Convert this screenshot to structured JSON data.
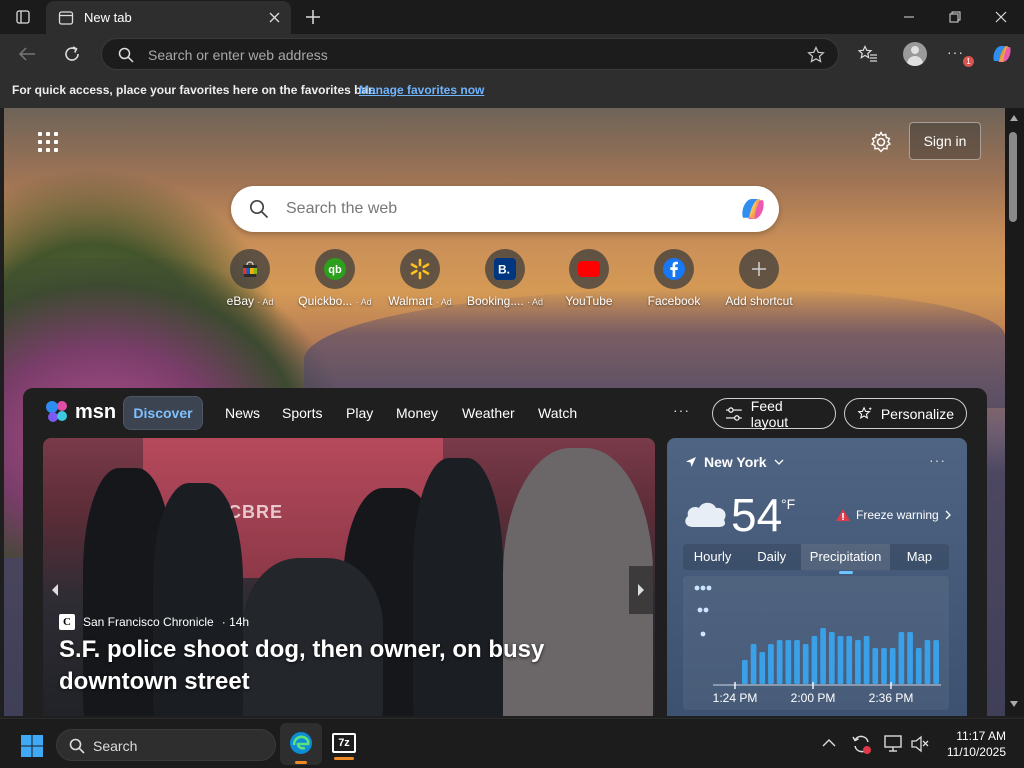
{
  "browser": {
    "tab_title": "New tab",
    "address_placeholder": "Search or enter web address",
    "favorites_message": "For quick access, place your favorites here on the favorites bar.",
    "favorites_link": "Manage favorites now",
    "profile_badge": "1"
  },
  "newtab": {
    "signin_label": "Sign in",
    "search_placeholder": "Search the web",
    "shortcuts": [
      {
        "label": "eBay",
        "ad": "· Ad",
        "icon": "ebay-icon",
        "color": "#4a4a4a"
      },
      {
        "label": "Quickbo...",
        "ad": "· Ad",
        "icon": "quickbooks-icon",
        "color": "#2ca01c"
      },
      {
        "label": "Walmart",
        "ad": "· Ad",
        "icon": "walmart-icon",
        "color": "#1a5ea8"
      },
      {
        "label": "Booking....",
        "ad": "· Ad",
        "icon": "booking-icon",
        "color": "#003580"
      },
      {
        "label": "YouTube",
        "ad": "",
        "icon": "youtube-icon",
        "color": "#ff0000"
      },
      {
        "label": "Facebook",
        "ad": "",
        "icon": "facebook-icon",
        "color": "#1877f2"
      },
      {
        "label": "Add shortcut",
        "ad": "",
        "icon": "plus-icon",
        "color": "#666666"
      }
    ]
  },
  "feed": {
    "brand": "msn",
    "nav": [
      "Discover",
      "News",
      "Sports",
      "Play",
      "Money",
      "Weather",
      "Watch"
    ],
    "more": "···",
    "feed_layout_label": "Feed layout",
    "personalize_label": "Personalize",
    "hero": {
      "source": "San Francisco Chronicle",
      "time": "· 14h",
      "sign_text": "CBRE",
      "headline": "S.F. police shoot dog, then owner, on busy downtown street"
    },
    "weather": {
      "location": "New York",
      "temperature": "54",
      "unit": "°F",
      "warning": "Freeze warning",
      "tabs": [
        "Hourly",
        "Daily",
        "Precipitation",
        "Map"
      ],
      "active_tab": "Precipitation",
      "more": "···"
    }
  },
  "chart_data": {
    "type": "bar",
    "title": "",
    "x_ticks": [
      "1:24 PM",
      "2:00 PM",
      "2:36 PM"
    ],
    "legend_icons": [
      "heavy-rain",
      "rain",
      "light-rain"
    ],
    "values": [
      0.3,
      0.5,
      0.4,
      0.5,
      0.55,
      0.55,
      0.55,
      0.5,
      0.6,
      0.7,
      0.65,
      0.6,
      0.6,
      0.55,
      0.6,
      0.45,
      0.45,
      0.45,
      0.65,
      0.65,
      0.45,
      0.55,
      0.55
    ],
    "color": "#3aa0e8",
    "ylim": [
      0,
      1
    ]
  },
  "taskbar": {
    "search_label": "Search",
    "time": "11:17 AM",
    "date": "11/10/2025"
  }
}
